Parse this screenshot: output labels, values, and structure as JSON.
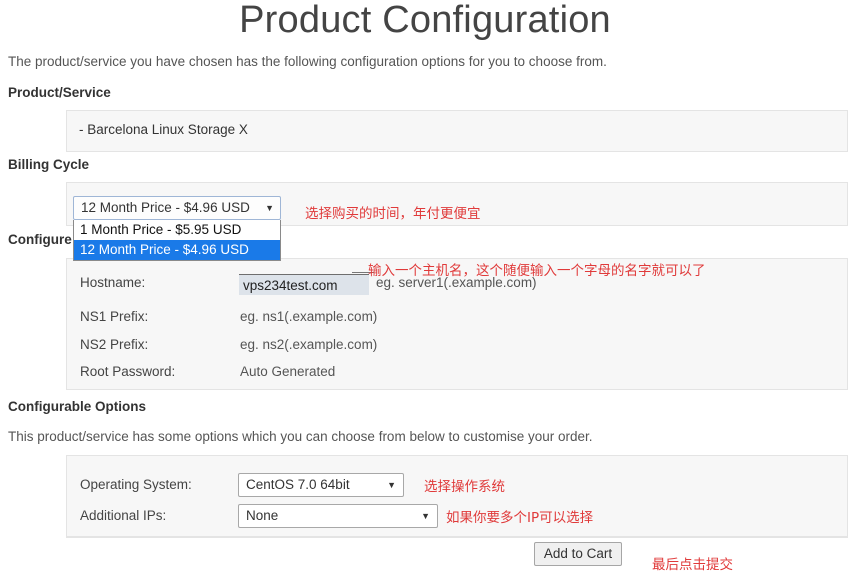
{
  "page": {
    "title": "Product Configuration",
    "intro": "The product/service you have chosen has the following configuration options for you to choose from."
  },
  "sections": {
    "product_service": {
      "heading": "Product/Service",
      "item": "- Barcelona Linux Storage X"
    },
    "billing_cycle": {
      "heading": "Billing Cycle",
      "select": {
        "value": "12 Month Price - $4.96 USD",
        "caret": "chevron-down-icon",
        "open": true,
        "options": [
          {
            "label": "1 Month Price - $5.95 USD",
            "selected": false
          },
          {
            "label": "12 Month Price - $4.96 USD",
            "selected": true
          }
        ]
      },
      "annotation": "选择购买的时间，年付更便宜"
    },
    "configure": {
      "heading": "Configure",
      "rows": [
        {
          "label": "Hostname:",
          "value": "",
          "input_value": "vps234test.com",
          "hint": "eg. server1(.example.com)"
        },
        {
          "label": "NS1 Prefix:",
          "value": "eg. ns1(.example.com)"
        },
        {
          "label": "NS2 Prefix:",
          "value": "eg. ns2(.example.com)"
        },
        {
          "label": "Root Password:",
          "value": "Auto Generated"
        }
      ],
      "annotation": "输入一个主机名，这个随便输入一个字母的名字就可以了"
    },
    "configurable_options": {
      "heading": "Configurable Options",
      "description": "This product/service has some options which you can choose from below to customise your order.",
      "rows": [
        {
          "label": "Operating System:",
          "value": "CentOS 7.0 64bit",
          "caret": "chevron-down-icon",
          "annotation": "选择操作系统"
        },
        {
          "label": "Additional IPs:",
          "value": "None",
          "caret": "chevron-down-icon",
          "annotation": "如果你要多个IP可以选择"
        }
      ]
    },
    "submit": {
      "button_label": "Add to Cart",
      "annotation": "最后点击提交"
    }
  },
  "colors": {
    "annotation_red": "#e03a3a",
    "dropdown_highlight_blue": "#1a7ae8",
    "panel_background": "#f7f7f7",
    "input_focus_background": "#dde3ea"
  }
}
